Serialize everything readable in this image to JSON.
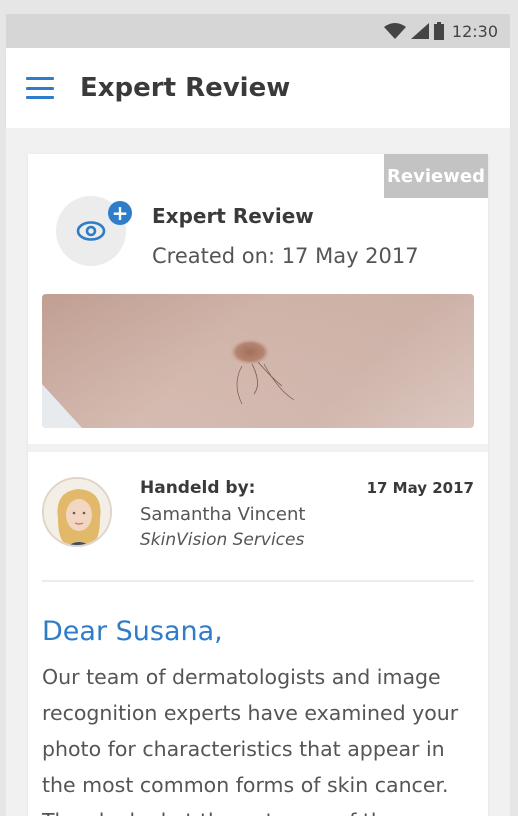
{
  "status_bar": {
    "time": "12:30",
    "icons": [
      "wifi-icon",
      "signal-icon",
      "battery-icon"
    ]
  },
  "header": {
    "title": "Expert Review",
    "menu_icon": "hamburger-menu-icon"
  },
  "review_card": {
    "badge": "Reviewed",
    "title": "Expert Review",
    "created": "Created on: 17 May 2017",
    "icons": [
      "eye-icon",
      "plus-icon"
    ]
  },
  "handler": {
    "label": "Handeld by:",
    "date": "17 May 2017",
    "name": "Samantha Vincent",
    "company": "SkinVision Services"
  },
  "message": {
    "greeting": "Dear Susana,",
    "text": "Our team of dermatologists and image recognition experts have examined your photo for characteristics that appear in the most common forms of skin cancer. They looked at the outcome of the"
  },
  "colors": {
    "accent": "#2f7cc8",
    "badge_bg": "#c3c3c3",
    "text_dark": "#3a3a3a",
    "text_body": "#555555"
  }
}
